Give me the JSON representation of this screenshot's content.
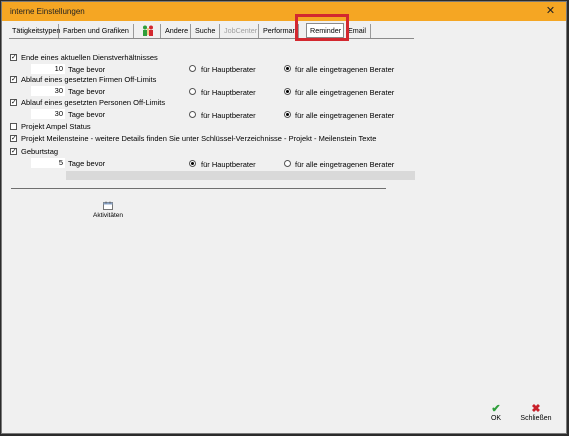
{
  "window": {
    "title": "interne Einstellungen"
  },
  "tabs": [
    {
      "label": "Tätigkeitstypen"
    },
    {
      "label": "Farben und Grafiken"
    },
    {
      "label": ""
    },
    {
      "label": "Andere"
    },
    {
      "label": "Suche"
    },
    {
      "label": "JobCenter"
    },
    {
      "label": "Performanc"
    },
    {
      "label": "Reminder"
    },
    {
      "label": "Email"
    }
  ],
  "reminders": {
    "r1": {
      "label": "Ende eines aktuellen Dienstverhältnisses",
      "days": "10",
      "unit": "Tage bevor",
      "opt_haupt": "für Hauptberater",
      "opt_alle": "für alle eingetragenen Berater"
    },
    "r2": {
      "label": "Ablauf eines gesetzten Firmen Off-Limits",
      "days": "30",
      "unit": "Tage bevor",
      "opt_haupt": "für Hauptberater",
      "opt_alle": "für alle eingetragenen Berater"
    },
    "r3": {
      "label": "Ablauf eines gesetzten Personen Off-Limits",
      "days": "30",
      "unit": "Tage bevor",
      "opt_haupt": "für Hauptberater",
      "opt_alle": "für alle eingetragenen Berater"
    },
    "ampel": {
      "label": "Projekt Ampel Status"
    },
    "meilen": {
      "label": "Projekt Meilensteine - weitere Details finden Sie unter Schlüssel-Verzeichnisse - Projekt - Meilenstein Texte"
    },
    "geb": {
      "label": "Geburtstag",
      "days": "5",
      "unit": "Tage bevor",
      "opt_haupt": "für Hauptberater",
      "opt_alle": "für alle eingetragenen Berater"
    }
  },
  "toolbar": {
    "activities_label": "Aktivitäten"
  },
  "buttons": {
    "ok": "OK",
    "close": "Schließen"
  },
  "colors": {
    "titlebar": "#f5a623",
    "highlight": "#d3282f",
    "ok_green": "#2e9e3a",
    "close_red": "#c8202a"
  }
}
